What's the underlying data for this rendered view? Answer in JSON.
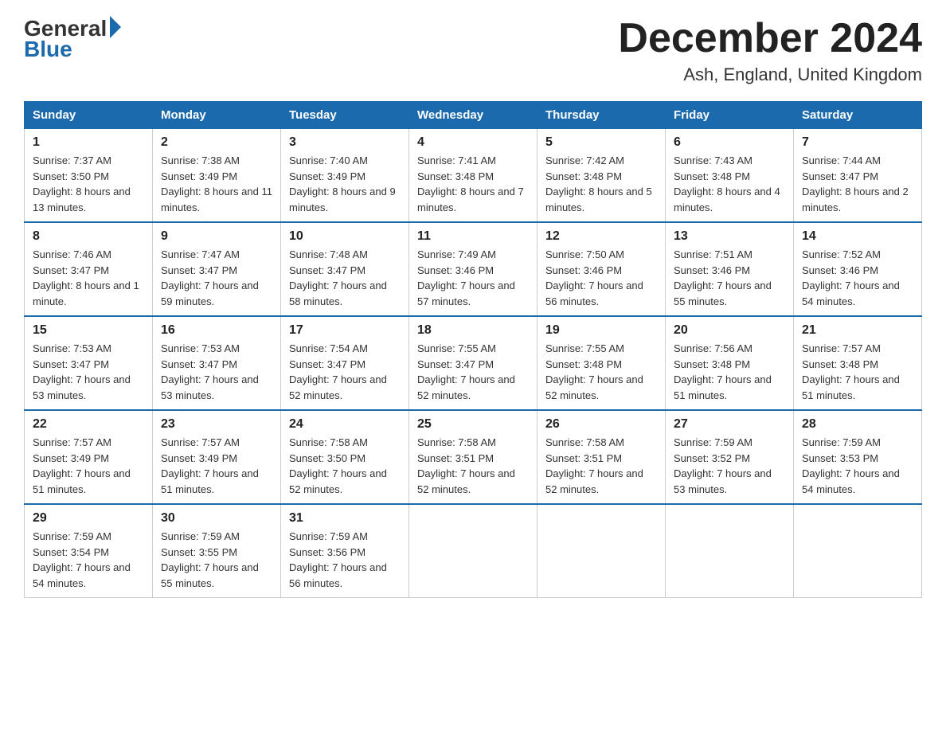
{
  "header": {
    "logo_general": "General",
    "logo_blue": "Blue",
    "title": "December 2024",
    "location": "Ash, England, United Kingdom"
  },
  "days_of_week": [
    "Sunday",
    "Monday",
    "Tuesday",
    "Wednesday",
    "Thursday",
    "Friday",
    "Saturday"
  ],
  "weeks": [
    [
      {
        "day": "1",
        "sunrise": "7:37 AM",
        "sunset": "3:50 PM",
        "daylight": "8 hours and 13 minutes."
      },
      {
        "day": "2",
        "sunrise": "7:38 AM",
        "sunset": "3:49 PM",
        "daylight": "8 hours and 11 minutes."
      },
      {
        "day": "3",
        "sunrise": "7:40 AM",
        "sunset": "3:49 PM",
        "daylight": "8 hours and 9 minutes."
      },
      {
        "day": "4",
        "sunrise": "7:41 AM",
        "sunset": "3:48 PM",
        "daylight": "8 hours and 7 minutes."
      },
      {
        "day": "5",
        "sunrise": "7:42 AM",
        "sunset": "3:48 PM",
        "daylight": "8 hours and 5 minutes."
      },
      {
        "day": "6",
        "sunrise": "7:43 AM",
        "sunset": "3:48 PM",
        "daylight": "8 hours and 4 minutes."
      },
      {
        "day": "7",
        "sunrise": "7:44 AM",
        "sunset": "3:47 PM",
        "daylight": "8 hours and 2 minutes."
      }
    ],
    [
      {
        "day": "8",
        "sunrise": "7:46 AM",
        "sunset": "3:47 PM",
        "daylight": "8 hours and 1 minute."
      },
      {
        "day": "9",
        "sunrise": "7:47 AM",
        "sunset": "3:47 PM",
        "daylight": "7 hours and 59 minutes."
      },
      {
        "day": "10",
        "sunrise": "7:48 AM",
        "sunset": "3:47 PM",
        "daylight": "7 hours and 58 minutes."
      },
      {
        "day": "11",
        "sunrise": "7:49 AM",
        "sunset": "3:46 PM",
        "daylight": "7 hours and 57 minutes."
      },
      {
        "day": "12",
        "sunrise": "7:50 AM",
        "sunset": "3:46 PM",
        "daylight": "7 hours and 56 minutes."
      },
      {
        "day": "13",
        "sunrise": "7:51 AM",
        "sunset": "3:46 PM",
        "daylight": "7 hours and 55 minutes."
      },
      {
        "day": "14",
        "sunrise": "7:52 AM",
        "sunset": "3:46 PM",
        "daylight": "7 hours and 54 minutes."
      }
    ],
    [
      {
        "day": "15",
        "sunrise": "7:53 AM",
        "sunset": "3:47 PM",
        "daylight": "7 hours and 53 minutes."
      },
      {
        "day": "16",
        "sunrise": "7:53 AM",
        "sunset": "3:47 PM",
        "daylight": "7 hours and 53 minutes."
      },
      {
        "day": "17",
        "sunrise": "7:54 AM",
        "sunset": "3:47 PM",
        "daylight": "7 hours and 52 minutes."
      },
      {
        "day": "18",
        "sunrise": "7:55 AM",
        "sunset": "3:47 PM",
        "daylight": "7 hours and 52 minutes."
      },
      {
        "day": "19",
        "sunrise": "7:55 AM",
        "sunset": "3:48 PM",
        "daylight": "7 hours and 52 minutes."
      },
      {
        "day": "20",
        "sunrise": "7:56 AM",
        "sunset": "3:48 PM",
        "daylight": "7 hours and 51 minutes."
      },
      {
        "day": "21",
        "sunrise": "7:57 AM",
        "sunset": "3:48 PM",
        "daylight": "7 hours and 51 minutes."
      }
    ],
    [
      {
        "day": "22",
        "sunrise": "7:57 AM",
        "sunset": "3:49 PM",
        "daylight": "7 hours and 51 minutes."
      },
      {
        "day": "23",
        "sunrise": "7:57 AM",
        "sunset": "3:49 PM",
        "daylight": "7 hours and 51 minutes."
      },
      {
        "day": "24",
        "sunrise": "7:58 AM",
        "sunset": "3:50 PM",
        "daylight": "7 hours and 52 minutes."
      },
      {
        "day": "25",
        "sunrise": "7:58 AM",
        "sunset": "3:51 PM",
        "daylight": "7 hours and 52 minutes."
      },
      {
        "day": "26",
        "sunrise": "7:58 AM",
        "sunset": "3:51 PM",
        "daylight": "7 hours and 52 minutes."
      },
      {
        "day": "27",
        "sunrise": "7:59 AM",
        "sunset": "3:52 PM",
        "daylight": "7 hours and 53 minutes."
      },
      {
        "day": "28",
        "sunrise": "7:59 AM",
        "sunset": "3:53 PM",
        "daylight": "7 hours and 54 minutes."
      }
    ],
    [
      {
        "day": "29",
        "sunrise": "7:59 AM",
        "sunset": "3:54 PM",
        "daylight": "7 hours and 54 minutes."
      },
      {
        "day": "30",
        "sunrise": "7:59 AM",
        "sunset": "3:55 PM",
        "daylight": "7 hours and 55 minutes."
      },
      {
        "day": "31",
        "sunrise": "7:59 AM",
        "sunset": "3:56 PM",
        "daylight": "7 hours and 56 minutes."
      },
      null,
      null,
      null,
      null
    ]
  ]
}
